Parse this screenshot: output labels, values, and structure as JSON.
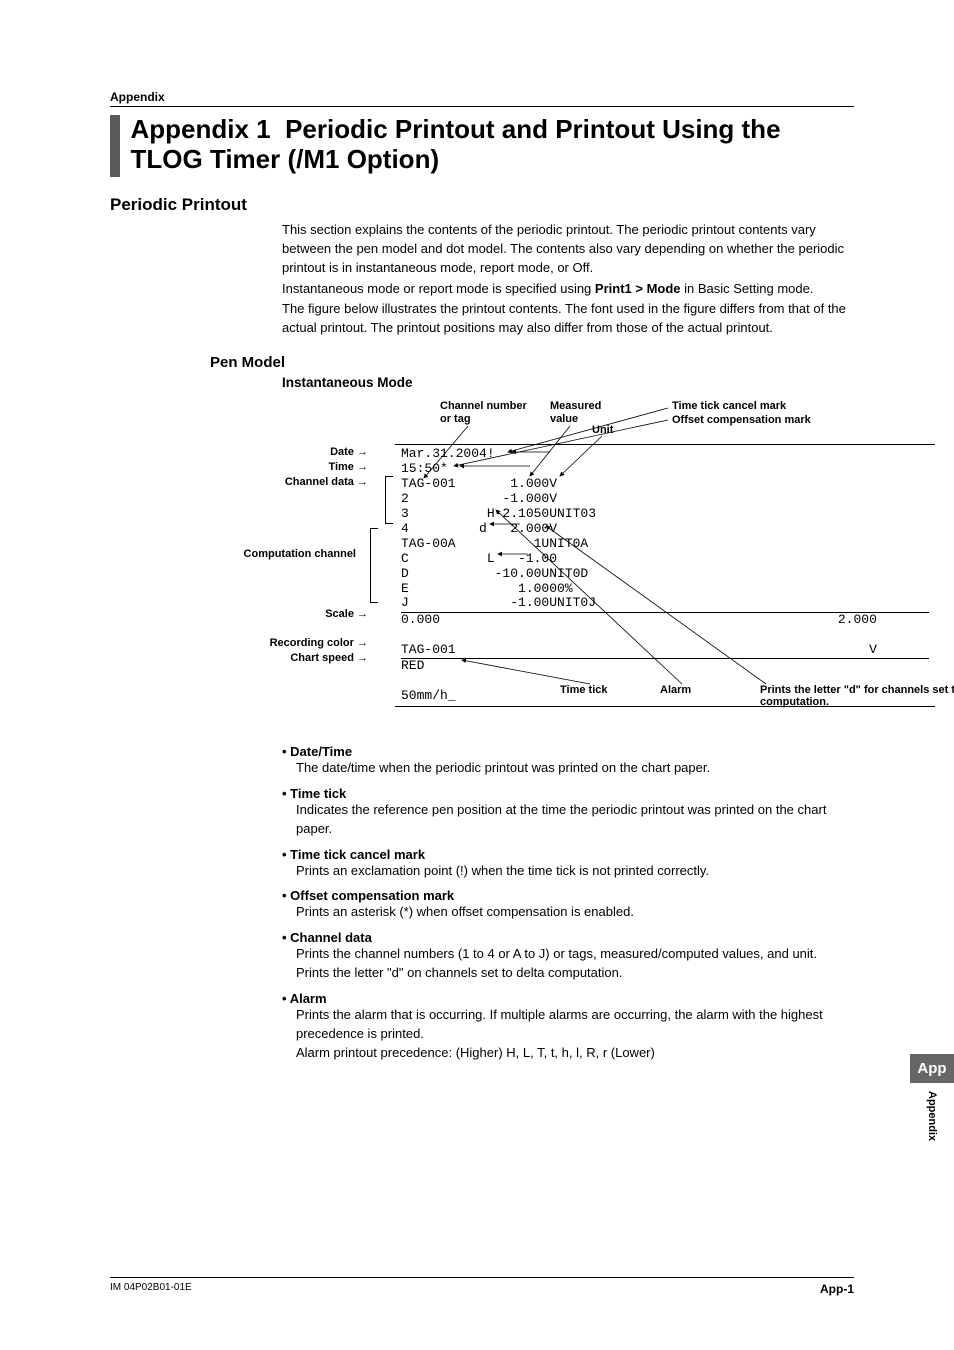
{
  "header": {
    "section": "Appendix"
  },
  "title": {
    "prefix": "Appendix 1",
    "main": "Periodic Printout and Printout Using the TLOG Timer (/M1 Option)"
  },
  "section1": {
    "heading": "Periodic Printout",
    "p1": "This section explains the contents of the periodic printout. The periodic printout contents vary between the pen model and dot model. The contents also vary depending on whether the periodic printout is in instantaneous mode, report mode, or Off.",
    "p2a": "Instantaneous mode or report mode is specified using ",
    "p2b": "Print1 > Mode",
    "p2c": " in Basic Setting mode.",
    "p3": "The figure below illustrates the printout contents. The font used in the figure differs from that of the actual printout. The printout positions may also differ from those of the actual printout."
  },
  "pen_model": {
    "heading": "Pen Model",
    "subheading": "Instantaneous Mode"
  },
  "figure": {
    "left_labels": {
      "date": "Date",
      "time": "Time",
      "channel_data": "Channel data",
      "computation_channel": "Computation channel",
      "scale": "Scale",
      "recording_color": "Recording color",
      "chart_speed": "Chart speed"
    },
    "top_labels": {
      "ch_or_tag": "Channel number\nor tag",
      "measured": "Measured\nvalue",
      "unit": "Unit",
      "cancel": "Time tick cancel mark",
      "offset": "Offset compensation mark"
    },
    "bottom_labels": {
      "time_tick": "Time tick",
      "alarm": "Alarm",
      "d_note": "Prints the letter \"d\" for channels set to delta computation."
    },
    "mono": {
      "l1": "Mar.31.2004!",
      "l2": "15:50*",
      "l3": "TAG-001       1.000V",
      "l4": "2            -1.000V",
      "l5": "3          H-2.1050UNIT03",
      "l6": "4         d   2.000V",
      "l7": "TAG-00A          1UNIT0A",
      "l8": "C          L   -1.00",
      "l9": "D           -10.00UNIT0D",
      "l10": "E              1.0000%",
      "l11": "J             -1.00UNIT0J",
      "l12": "0.000                                                   2.000",
      "l13": "TAG-001                                                     V",
      "l14": "RED",
      "l15": "50mm/h_"
    }
  },
  "bullets": [
    {
      "head": "Date/Time",
      "body": [
        "The date/time when the periodic printout was printed on the chart paper."
      ]
    },
    {
      "head": "Time tick",
      "body": [
        "Indicates the reference pen position at the time the periodic printout was printed on the chart paper."
      ]
    },
    {
      "head": "Time tick cancel mark",
      "body": [
        "Prints an exclamation point (!) when the time tick is not printed correctly."
      ]
    },
    {
      "head": "Offset compensation mark",
      "body": [
        "Prints an asterisk (*) when offset compensation is enabled."
      ]
    },
    {
      "head": "Channel data",
      "body": [
        "Prints the channel numbers (1 to 4 or A to J) or tags, measured/computed values, and unit.",
        "Prints the letter \"d\" on channels set to delta computation."
      ]
    },
    {
      "head": "Alarm",
      "body": [
        "Prints the alarm that is occurring. If multiple alarms are occurring, the alarm with the highest precedence is printed.",
        "Alarm printout precedence: (Higher) H, L, T, t, h, l, R, r (Lower)"
      ]
    }
  ],
  "side_tab": {
    "box": "App",
    "vert": "Appendix"
  },
  "footer": {
    "left": "IM 04P02B01-01E",
    "right": "App-1"
  }
}
